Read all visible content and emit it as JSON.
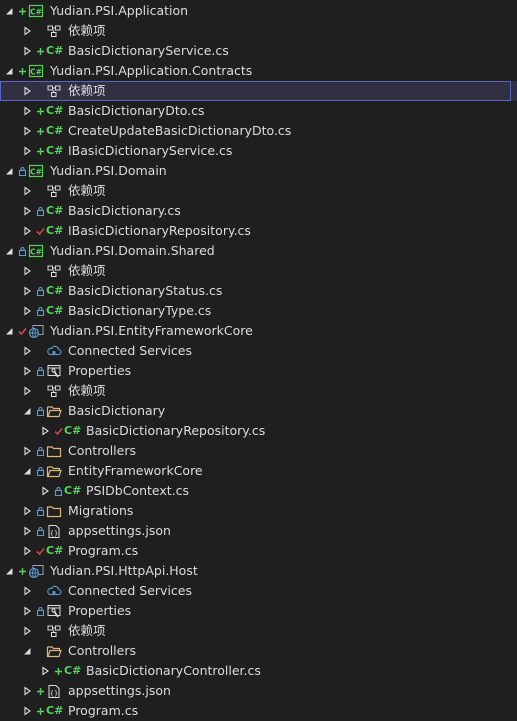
{
  "colors": {
    "background": "#1f1f1f",
    "text": "#dcdcdc",
    "csharp_green": "#57d35c",
    "added_plus": "#57d35c",
    "lock_blue": "#5b9bd5",
    "check_red": "#d74b4b",
    "selection_border": "#5865c7",
    "folder": "#dcb67a"
  },
  "tree": [
    {
      "level": 0,
      "expanded": true,
      "status": "added",
      "icon": "csharp-project",
      "label": "Yudian.PSI.Application"
    },
    {
      "level": 1,
      "expanded": false,
      "status": "none",
      "icon": "dependencies",
      "label": "依赖项"
    },
    {
      "level": 1,
      "expanded": false,
      "status": "added",
      "icon": "csharp-file",
      "label": "BasicDictionaryService.cs"
    },
    {
      "level": 0,
      "expanded": true,
      "status": "added",
      "icon": "csharp-project",
      "label": "Yudian.PSI.Application.Contracts"
    },
    {
      "level": 1,
      "expanded": false,
      "status": "none",
      "icon": "dependencies",
      "label": "依赖项",
      "selected": true
    },
    {
      "level": 1,
      "expanded": false,
      "status": "added",
      "icon": "csharp-file",
      "label": "BasicDictionaryDto.cs"
    },
    {
      "level": 1,
      "expanded": false,
      "status": "added",
      "icon": "csharp-file",
      "label": "CreateUpdateBasicDictionaryDto.cs"
    },
    {
      "level": 1,
      "expanded": false,
      "status": "added",
      "icon": "csharp-file",
      "label": "IBasicDictionaryService.cs"
    },
    {
      "level": 0,
      "expanded": true,
      "status": "locked",
      "icon": "csharp-project",
      "label": "Yudian.PSI.Domain"
    },
    {
      "level": 1,
      "expanded": false,
      "status": "none",
      "icon": "dependencies",
      "label": "依赖项"
    },
    {
      "level": 1,
      "expanded": false,
      "status": "locked",
      "icon": "csharp-file",
      "label": "BasicDictionary.cs"
    },
    {
      "level": 1,
      "expanded": false,
      "status": "checked",
      "icon": "csharp-file",
      "label": "IBasicDictionaryRepository.cs"
    },
    {
      "level": 0,
      "expanded": true,
      "status": "locked",
      "icon": "csharp-project",
      "label": "Yudian.PSI.Domain.Shared"
    },
    {
      "level": 1,
      "expanded": false,
      "status": "none",
      "icon": "dependencies",
      "label": "依赖项"
    },
    {
      "level": 1,
      "expanded": false,
      "status": "locked",
      "icon": "csharp-file",
      "label": "BasicDictionaryStatus.cs"
    },
    {
      "level": 1,
      "expanded": false,
      "status": "locked",
      "icon": "csharp-file",
      "label": "BasicDictionaryType.cs"
    },
    {
      "level": 0,
      "expanded": true,
      "status": "checked",
      "icon": "web-project",
      "label": "Yudian.PSI.EntityFrameworkCore"
    },
    {
      "level": 1,
      "expanded": false,
      "status": "none",
      "icon": "connected-services",
      "label": "Connected Services"
    },
    {
      "level": 1,
      "expanded": false,
      "status": "locked",
      "icon": "properties",
      "label": "Properties"
    },
    {
      "level": 1,
      "expanded": false,
      "status": "none",
      "icon": "dependencies",
      "label": "依赖项"
    },
    {
      "level": 1,
      "expanded": true,
      "status": "locked",
      "icon": "folder-open",
      "label": "BasicDictionary"
    },
    {
      "level": 2,
      "expanded": false,
      "status": "checked",
      "icon": "csharp-file",
      "label": "BasicDictionaryRepository.cs"
    },
    {
      "level": 1,
      "expanded": false,
      "status": "locked",
      "icon": "folder",
      "label": "Controllers"
    },
    {
      "level": 1,
      "expanded": true,
      "status": "locked",
      "icon": "folder-open",
      "label": "EntityFrameworkCore"
    },
    {
      "level": 2,
      "expanded": false,
      "status": "locked",
      "icon": "csharp-file",
      "label": "PSIDbContext.cs"
    },
    {
      "level": 1,
      "expanded": false,
      "status": "locked",
      "icon": "folder",
      "label": "Migrations"
    },
    {
      "level": 1,
      "expanded": false,
      "status": "locked",
      "icon": "json-file",
      "label": "appsettings.json"
    },
    {
      "level": 1,
      "expanded": false,
      "status": "checked",
      "icon": "csharp-file",
      "label": "Program.cs"
    },
    {
      "level": 0,
      "expanded": true,
      "status": "added",
      "icon": "web-project",
      "label": "Yudian.PSI.HttpApi.Host"
    },
    {
      "level": 1,
      "expanded": false,
      "status": "none",
      "icon": "connected-services",
      "label": "Connected Services"
    },
    {
      "level": 1,
      "expanded": false,
      "status": "locked",
      "icon": "properties",
      "label": "Properties"
    },
    {
      "level": 1,
      "expanded": false,
      "status": "none",
      "icon": "dependencies",
      "label": "依赖项"
    },
    {
      "level": 1,
      "expanded": true,
      "status": "none",
      "icon": "folder-open",
      "label": "Controllers"
    },
    {
      "level": 2,
      "expanded": false,
      "status": "added",
      "icon": "csharp-file",
      "label": "BasicDictionaryController.cs"
    },
    {
      "level": 1,
      "expanded": false,
      "status": "added",
      "icon": "json-file",
      "label": "appsettings.json"
    },
    {
      "level": 1,
      "expanded": false,
      "status": "added",
      "icon": "csharp-file",
      "label": "Program.cs"
    }
  ]
}
